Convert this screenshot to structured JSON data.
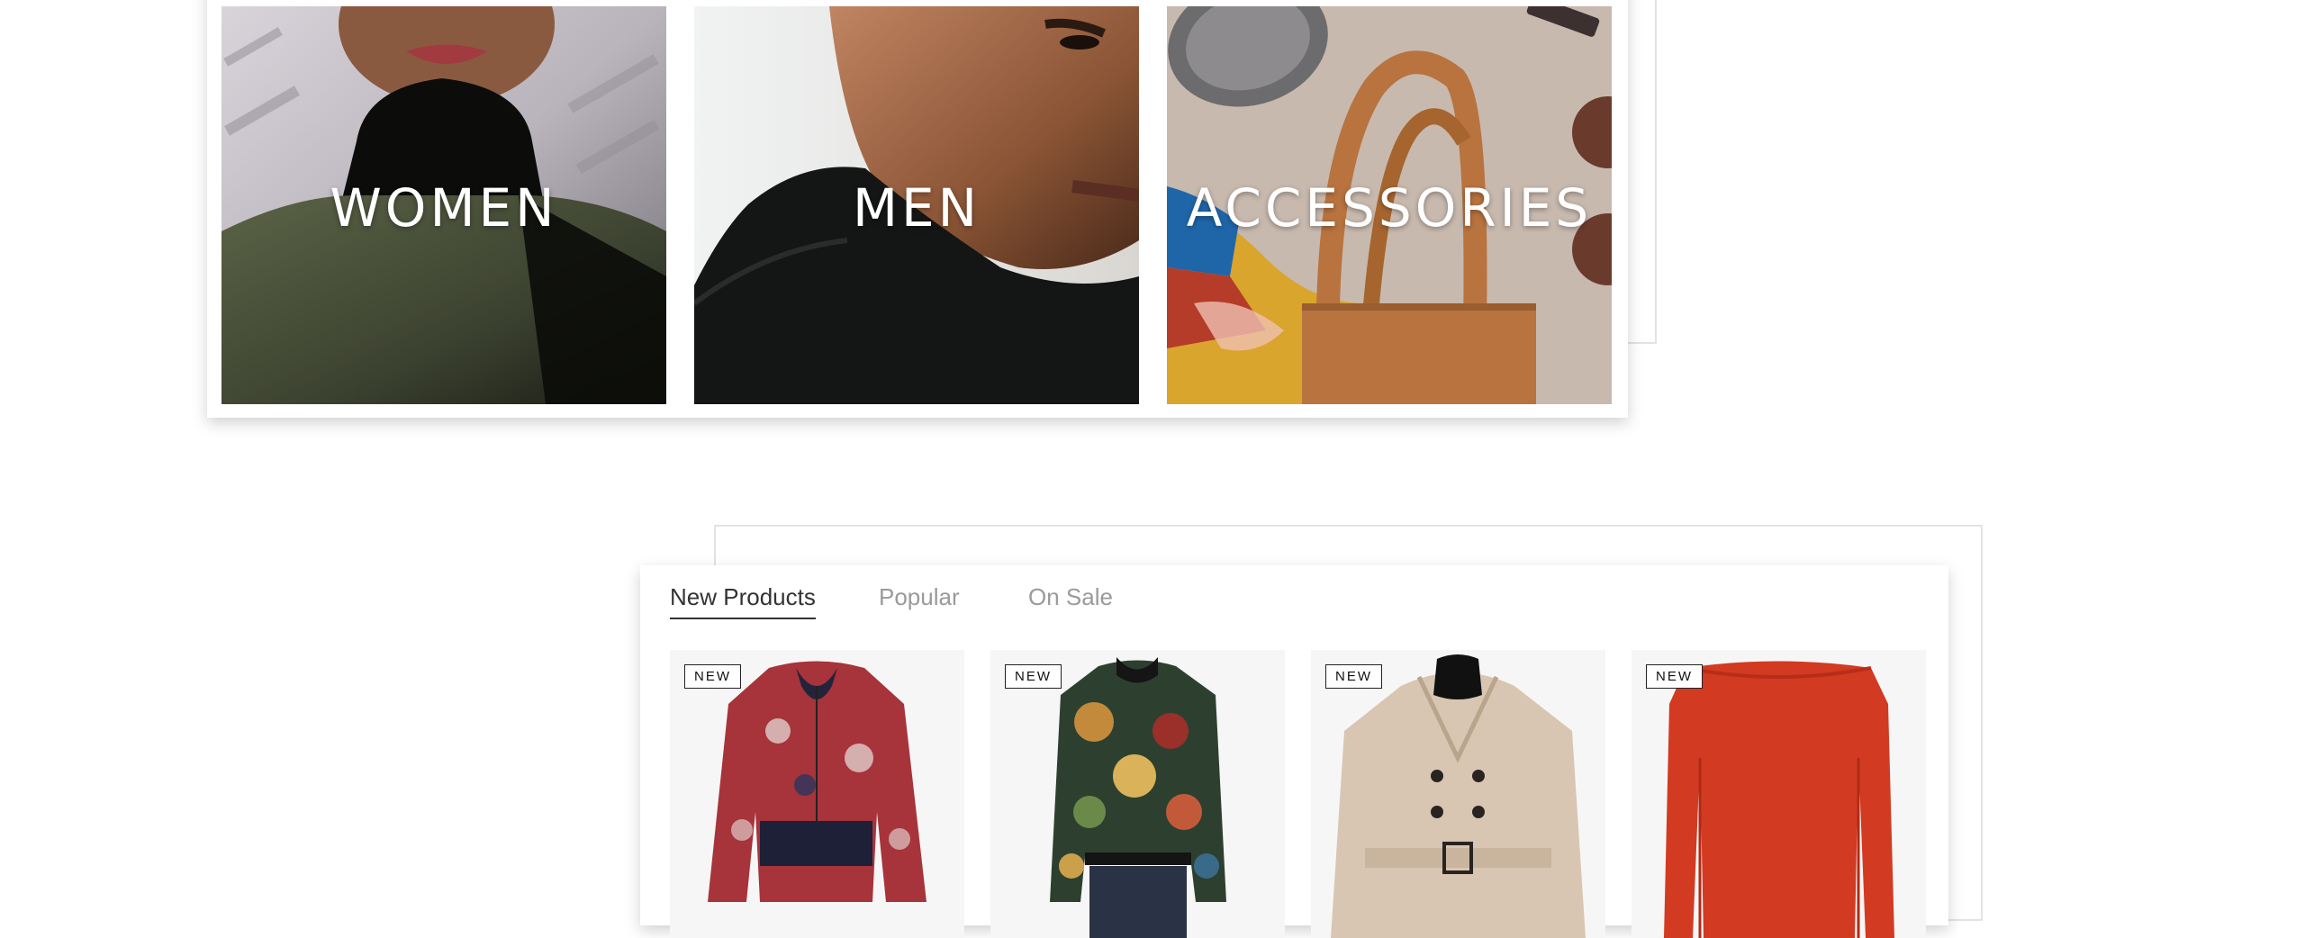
{
  "categories": {
    "items": [
      {
        "label": "WOMEN"
      },
      {
        "label": "MEN"
      },
      {
        "label": "ACCESSORIES"
      }
    ]
  },
  "products": {
    "tabs": [
      {
        "label": "New Products",
        "active": true
      },
      {
        "label": "Popular",
        "active": false
      },
      {
        "label": "On Sale",
        "active": false
      }
    ],
    "items": [
      {
        "badge": "NEW",
        "image": "red-paisley-bomber-jacket"
      },
      {
        "badge": "NEW",
        "image": "floral-print-bomber-jacket"
      },
      {
        "badge": "NEW",
        "image": "beige-trench-coat"
      },
      {
        "badge": "NEW",
        "image": "red-long-sleeve-dress"
      }
    ]
  },
  "colors": {
    "tab_active": "#333333",
    "tab_inactive": "#9a9a9a",
    "card_border": "#e3e3e3"
  }
}
